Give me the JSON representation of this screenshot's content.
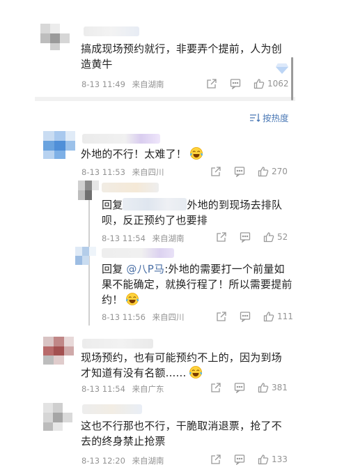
{
  "top_comment": {
    "text": "搞成现场预约就行，非要弄个提前，人为创造黄牛",
    "time": "8-13 11:49",
    "location": "来自湖南",
    "likes": "1062"
  },
  "sort": {
    "label": "按热度"
  },
  "comments": [
    {
      "text": "外地的不行！太难了！",
      "time": "8-13 11:53",
      "location": "来自四川",
      "likes": "270"
    },
    {
      "reply_prefix": "回复",
      "text": "外地的到现场去排队呗，反正预约了也要排",
      "time": "8-13 11:54",
      "location": "来自湖南",
      "likes": "52"
    },
    {
      "reply_prefix": "回复",
      "mention": "@八P马",
      "text": ":外地的需要打一个前量如果不能确定，就换行程了！所以需要提前约！",
      "time": "8-13 11:56",
      "location": "来自四川",
      "likes": "111"
    },
    {
      "text": "现场预约，也有可能预约不上的，因为到场才知道有没有名额......",
      "time": "8-13 11:54",
      "location": "来自广东",
      "likes": "381"
    },
    {
      "text": "这也不行那也不行，干脆取消退票，抢了不去的终身禁止抢票",
      "time": "8-13 12:20",
      "location": "来自湖南",
      "likes": "133"
    }
  ],
  "icons": [
    "share-icon",
    "comment-icon",
    "like-icon",
    "sort-icon",
    "laugh-cry-emoji"
  ]
}
